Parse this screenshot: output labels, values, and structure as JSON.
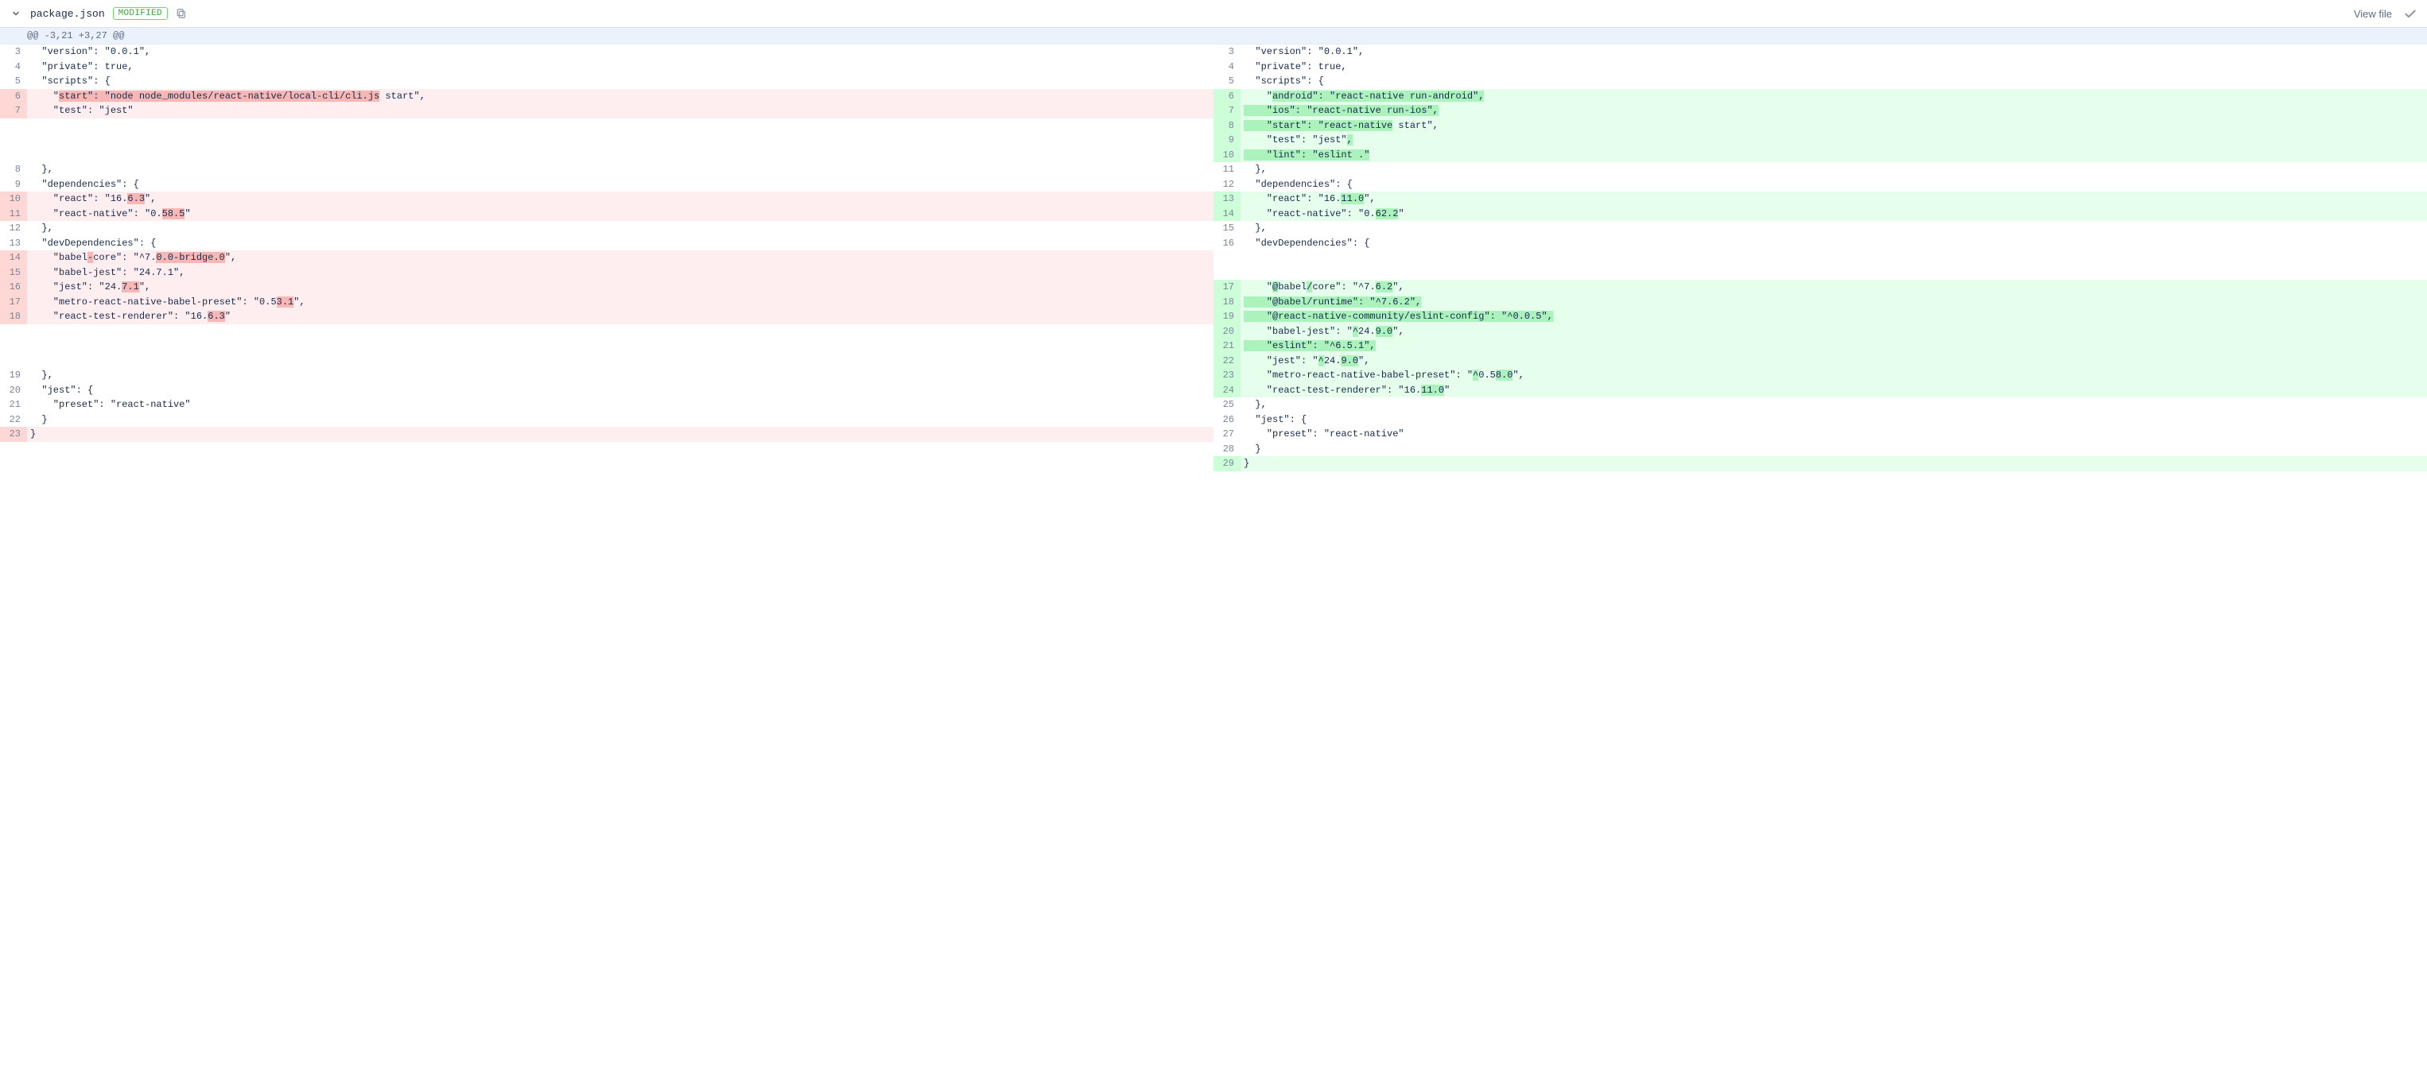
{
  "header": {
    "filename": "package.json",
    "status": "MODIFIED",
    "view_file": "View file"
  },
  "hunk_header": "@@ -3,21 +3,27 @@",
  "left": [
    {
      "t": "ctx",
      "n": "3",
      "segs": [
        {
          "h": false,
          "v": "  \"version\": \"0.0.1\","
        }
      ]
    },
    {
      "t": "ctx",
      "n": "4",
      "segs": [
        {
          "h": false,
          "v": "  \"private\": true,"
        }
      ]
    },
    {
      "t": "ctx",
      "n": "5",
      "segs": [
        {
          "h": false,
          "v": "  \"scripts\": {"
        }
      ]
    },
    {
      "t": "del",
      "n": "6",
      "segs": [
        {
          "h": false,
          "v": "    \""
        },
        {
          "h": true,
          "v": "start\": \"node node_modules/react-native/local-cli/cli.js"
        },
        {
          "h": false,
          "v": " start\","
        }
      ]
    },
    {
      "t": "del",
      "n": "7",
      "segs": [
        {
          "h": false,
          "v": "    \"test\": \"jest\""
        }
      ]
    },
    {
      "t": "empty"
    },
    {
      "t": "empty"
    },
    {
      "t": "empty"
    },
    {
      "t": "ctx",
      "n": "8",
      "segs": [
        {
          "h": false,
          "v": "  },"
        }
      ]
    },
    {
      "t": "ctx",
      "n": "9",
      "segs": [
        {
          "h": false,
          "v": "  \"dependencies\": {"
        }
      ]
    },
    {
      "t": "del",
      "n": "10",
      "segs": [
        {
          "h": false,
          "v": "    \"react\": \"16."
        },
        {
          "h": true,
          "v": "6.3"
        },
        {
          "h": false,
          "v": "\","
        }
      ]
    },
    {
      "t": "del",
      "n": "11",
      "segs": [
        {
          "h": false,
          "v": "    \"react-native\": \"0."
        },
        {
          "h": true,
          "v": "58.5"
        },
        {
          "h": false,
          "v": "\""
        }
      ]
    },
    {
      "t": "ctx",
      "n": "12",
      "segs": [
        {
          "h": false,
          "v": "  },"
        }
      ]
    },
    {
      "t": "ctx",
      "n": "13",
      "segs": [
        {
          "h": false,
          "v": "  \"devDependencies\": {"
        }
      ]
    },
    {
      "t": "del",
      "n": "14",
      "segs": [
        {
          "h": false,
          "v": "    \"babel"
        },
        {
          "h": true,
          "v": "-"
        },
        {
          "h": false,
          "v": "core\": \"^7."
        },
        {
          "h": true,
          "v": "0.0-bridge.0"
        },
        {
          "h": false,
          "v": "\","
        }
      ]
    },
    {
      "t": "del",
      "n": "15",
      "segs": [
        {
          "h": false,
          "v": "    \"babel-jest\": \"24.7.1\","
        }
      ]
    },
    {
      "t": "del",
      "n": "16",
      "segs": [
        {
          "h": false,
          "v": "    \"jest\": \"24."
        },
        {
          "h": true,
          "v": "7.1"
        },
        {
          "h": false,
          "v": "\","
        }
      ]
    },
    {
      "t": "del",
      "n": "17",
      "segs": [
        {
          "h": false,
          "v": "    \"metro-react-native-babel-preset\": \"0.5"
        },
        {
          "h": true,
          "v": "3.1"
        },
        {
          "h": false,
          "v": "\","
        }
      ]
    },
    {
      "t": "del",
      "n": "18",
      "segs": [
        {
          "h": false,
          "v": "    \"react-test-renderer\": \"16."
        },
        {
          "h": true,
          "v": "6.3"
        },
        {
          "h": false,
          "v": "\""
        }
      ]
    },
    {
      "t": "empty"
    },
    {
      "t": "empty"
    },
    {
      "t": "empty"
    },
    {
      "t": "ctx",
      "n": "19",
      "segs": [
        {
          "h": false,
          "v": "  },"
        }
      ]
    },
    {
      "t": "ctx",
      "n": "20",
      "segs": [
        {
          "h": false,
          "v": "  \"jest\": {"
        }
      ]
    },
    {
      "t": "ctx",
      "n": "21",
      "segs": [
        {
          "h": false,
          "v": "    \"preset\": \"react-native\""
        }
      ]
    },
    {
      "t": "ctx",
      "n": "22",
      "segs": [
        {
          "h": false,
          "v": "  }"
        }
      ]
    },
    {
      "t": "del",
      "n": "23",
      "segs": [
        {
          "h": false,
          "v": "}"
        }
      ]
    }
  ],
  "right": [
    {
      "t": "ctx",
      "n": "3",
      "segs": [
        {
          "h": false,
          "v": "  \"version\": \"0.0.1\","
        }
      ]
    },
    {
      "t": "ctx",
      "n": "4",
      "segs": [
        {
          "h": false,
          "v": "  \"private\": true,"
        }
      ]
    },
    {
      "t": "ctx",
      "n": "5",
      "segs": [
        {
          "h": false,
          "v": "  \"scripts\": {"
        }
      ]
    },
    {
      "t": "add",
      "n": "6",
      "segs": [
        {
          "h": false,
          "v": "    \""
        },
        {
          "h": true,
          "v": "android\": \"react-native run-android\","
        }
      ]
    },
    {
      "t": "add",
      "n": "7",
      "segs": [
        {
          "h": true,
          "v": "    \"ios\": \"react-native run-ios\","
        }
      ]
    },
    {
      "t": "add",
      "n": "8",
      "segs": [
        {
          "h": true,
          "v": "    \"start\": \"react-native"
        },
        {
          "h": false,
          "v": " start\","
        }
      ]
    },
    {
      "t": "add",
      "n": "9",
      "segs": [
        {
          "h": false,
          "v": "    \"test\": \"jest\""
        },
        {
          "h": true,
          "v": ","
        }
      ]
    },
    {
      "t": "add",
      "n": "10",
      "segs": [
        {
          "h": true,
          "v": "    \"lint\": \"eslint .\""
        }
      ]
    },
    {
      "t": "ctx",
      "n": "11",
      "segs": [
        {
          "h": false,
          "v": "  },"
        }
      ]
    },
    {
      "t": "ctx",
      "n": "12",
      "segs": [
        {
          "h": false,
          "v": "  \"dependencies\": {"
        }
      ]
    },
    {
      "t": "add",
      "n": "13",
      "segs": [
        {
          "h": false,
          "v": "    \"react\": \"16."
        },
        {
          "h": true,
          "v": "11.0"
        },
        {
          "h": false,
          "v": "\","
        }
      ]
    },
    {
      "t": "add",
      "n": "14",
      "segs": [
        {
          "h": false,
          "v": "    \"react-native\": \"0."
        },
        {
          "h": true,
          "v": "62.2"
        },
        {
          "h": false,
          "v": "\""
        }
      ]
    },
    {
      "t": "ctx",
      "n": "15",
      "segs": [
        {
          "h": false,
          "v": "  },"
        }
      ]
    },
    {
      "t": "ctx",
      "n": "16",
      "segs": [
        {
          "h": false,
          "v": "  \"devDependencies\": {"
        }
      ]
    },
    {
      "t": "empty"
    },
    {
      "t": "empty"
    },
    {
      "t": "add",
      "n": "17",
      "segs": [
        {
          "h": false,
          "v": "    \""
        },
        {
          "h": true,
          "v": "@"
        },
        {
          "h": false,
          "v": "babel"
        },
        {
          "h": true,
          "v": "/"
        },
        {
          "h": false,
          "v": "core\": \"^7."
        },
        {
          "h": true,
          "v": "6.2"
        },
        {
          "h": false,
          "v": "\","
        }
      ]
    },
    {
      "t": "add",
      "n": "18",
      "segs": [
        {
          "h": true,
          "v": "    \"@babel/runtime\": \"^7.6.2\","
        }
      ]
    },
    {
      "t": "add",
      "n": "19",
      "segs": [
        {
          "h": true,
          "v": "    \"@react-native-community/eslint-config\": \"^0.0.5\","
        }
      ]
    },
    {
      "t": "add",
      "n": "20",
      "segs": [
        {
          "h": false,
          "v": "    \"babel-jest\": \""
        },
        {
          "h": true,
          "v": "^"
        },
        {
          "h": false,
          "v": "24."
        },
        {
          "h": true,
          "v": "9.0"
        },
        {
          "h": false,
          "v": "\","
        }
      ]
    },
    {
      "t": "add",
      "n": "21",
      "segs": [
        {
          "h": true,
          "v": "    \"eslint\": \"^6.5.1\","
        }
      ]
    },
    {
      "t": "add",
      "n": "22",
      "segs": [
        {
          "h": false,
          "v": "    \"jest\": \""
        },
        {
          "h": true,
          "v": "^"
        },
        {
          "h": false,
          "v": "24."
        },
        {
          "h": true,
          "v": "9.0"
        },
        {
          "h": false,
          "v": "\","
        }
      ]
    },
    {
      "t": "add",
      "n": "23",
      "segs": [
        {
          "h": false,
          "v": "    \"metro-react-native-babel-preset\": \""
        },
        {
          "h": true,
          "v": "^"
        },
        {
          "h": false,
          "v": "0.5"
        },
        {
          "h": true,
          "v": "8.0"
        },
        {
          "h": false,
          "v": "\","
        }
      ]
    },
    {
      "t": "add",
      "n": "24",
      "segs": [
        {
          "h": false,
          "v": "    \"react-test-renderer\": \"16."
        },
        {
          "h": true,
          "v": "11.0"
        },
        {
          "h": false,
          "v": "\""
        }
      ]
    },
    {
      "t": "ctx",
      "n": "25",
      "segs": [
        {
          "h": false,
          "v": "  },"
        }
      ]
    },
    {
      "t": "ctx",
      "n": "26",
      "segs": [
        {
          "h": false,
          "v": "  \"jest\": {"
        }
      ]
    },
    {
      "t": "ctx",
      "n": "27",
      "segs": [
        {
          "h": false,
          "v": "    \"preset\": \"react-native\""
        }
      ]
    },
    {
      "t": "ctx",
      "n": "28",
      "segs": [
        {
          "h": false,
          "v": "  }"
        }
      ]
    },
    {
      "t": "add",
      "n": "29",
      "segs": [
        {
          "h": false,
          "v": "}"
        }
      ]
    }
  ]
}
